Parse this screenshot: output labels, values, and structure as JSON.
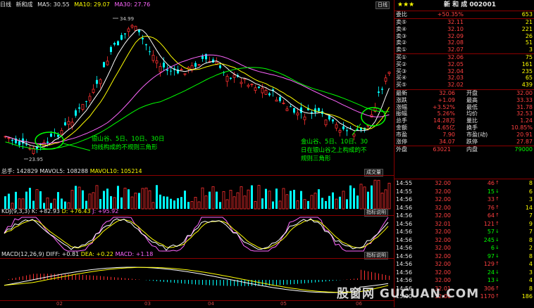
{
  "header": {
    "period": "日线",
    "stock_name": "新和成",
    "ma5": "MA5: 30.55",
    "ma10": "MA10: 29.07",
    "ma30": "MA30: 27.76",
    "top_right_label": "日线"
  },
  "main_chart": {
    "high_label": "34.99",
    "low_label": "23.95",
    "annotation_left_1": "银山谷、5日、10日、30日",
    "annotation_left_2": "均线构成的不规则三角形",
    "annotation_right_1": "金山谷、5日、10日、30",
    "annotation_right_2": "日在银山谷之上构成的不",
    "annotation_right_3": "规则三角形"
  },
  "volume_panel": {
    "total": "总手: 142829",
    "mavol5": "MAVOL5: 108288",
    "mavol10": "MAVOL10: 105214",
    "button": "成交量"
  },
  "kdj_panel": {
    "label": "KDJ(9,3,3)",
    "k": "K: +82.93",
    "d": "D: +76.43",
    "j": "J: +95.92",
    "button": "指标说明"
  },
  "macd_panel": {
    "label": "MACD(12,26,9)",
    "diff": "DIFF: +0.81",
    "dea": "DEA: +0.22",
    "macd": "MACD: +1.18",
    "button": "指标说明"
  },
  "x_axis": [
    "02",
    "03",
    "04",
    "05",
    "06"
  ],
  "watermark": "股窗网 GUCUAN.COM",
  "right_panel": {
    "stars": "★★★",
    "title": "新 和 成 002001",
    "weibi": {
      "label": "委比",
      "value": "+50.35%",
      "vol": "653"
    },
    "asks": [
      {
        "label": "卖⑤",
        "price": "32.11",
        "vol": "21"
      },
      {
        "label": "卖④",
        "price": "32.10",
        "vol": "221"
      },
      {
        "label": "卖③",
        "price": "32.09",
        "vol": "26"
      },
      {
        "label": "卖②",
        "price": "32.08",
        "vol": "51"
      },
      {
        "label": "卖①",
        "price": "32.07",
        "vol": "3"
      }
    ],
    "bids": [
      {
        "label": "买①",
        "price": "32.06",
        "vol": "75"
      },
      {
        "label": "买②",
        "price": "32.05",
        "vol": "161"
      },
      {
        "label": "买③",
        "price": "32.04",
        "vol": "235"
      },
      {
        "label": "买④",
        "price": "32.03",
        "vol": "65"
      },
      {
        "label": "买⑤",
        "price": "32.02",
        "vol": "439"
      }
    ],
    "stats": [
      {
        "l1": "最新",
        "v1": "32.06",
        "l2": "开盘",
        "v2": "32.00"
      },
      {
        "l1": "涨跌",
        "v1": "+1.09",
        "l2": "最高",
        "v2": "33.33"
      },
      {
        "l1": "涨幅",
        "v1": "+3.52%",
        "l2": "最低",
        "v2": "31.78"
      },
      {
        "l1": "振幅",
        "v1": "5.26%",
        "l2": "均价",
        "v2": "32.53"
      },
      {
        "l1": "总手",
        "v1": "14.28万",
        "l2": "量比",
        "v2": "1.24"
      },
      {
        "l1": "金额",
        "v1": "4.65亿",
        "l2": "换手",
        "v2": "10.85%"
      },
      {
        "l1": "市盈",
        "v1": "7.90",
        "l2": "市盈(动)",
        "v2": "20.91"
      },
      {
        "l1": "涨停",
        "v1": "34.07",
        "l2": "跌停",
        "v2": "27.87"
      }
    ],
    "outer": {
      "l1": "外盘",
      "v1": "63021",
      "l2": "内盘",
      "v2": "79000"
    },
    "ticks": [
      {
        "time": "14:55",
        "price": "32.00",
        "vol": "46",
        "dir": "up",
        "n": "8"
      },
      {
        "time": "14:55",
        "price": "32.00",
        "vol": "15",
        "dir": "down",
        "n": "6"
      },
      {
        "time": "14:56",
        "price": "32.00",
        "vol": "33",
        "dir": "up",
        "n": "3"
      },
      {
        "time": "14:56",
        "price": "32.00",
        "vol": "76",
        "dir": "up",
        "n": "14"
      },
      {
        "time": "14:56",
        "price": "32.00",
        "vol": "64",
        "dir": "up",
        "n": "7"
      },
      {
        "time": "14:56",
        "price": "32.01",
        "vol": "121",
        "dir": "up",
        "n": "9"
      },
      {
        "time": "14:56",
        "price": "32.00",
        "vol": "57",
        "dir": "down",
        "n": "7"
      },
      {
        "time": "14:56",
        "price": "32.00",
        "vol": "245",
        "dir": "down",
        "n": "8"
      },
      {
        "time": "14:56",
        "price": "32.00",
        "vol": "6",
        "dir": "down",
        "n": "2"
      },
      {
        "time": "14:56",
        "price": "32.00",
        "vol": "97",
        "dir": "down",
        "n": "8"
      },
      {
        "time": "14:56",
        "price": "32.00",
        "vol": "129",
        "dir": "up",
        "n": "4"
      },
      {
        "time": "14:56",
        "price": "32.00",
        "vol": "24",
        "dir": "down",
        "n": "3"
      },
      {
        "time": "14:56",
        "price": "32.00",
        "vol": "13",
        "dir": "down",
        "n": "4"
      },
      {
        "time": "14:56",
        "price": "32.01",
        "vol": "306",
        "dir": "up",
        "n": "8"
      },
      {
        "time": "15:00",
        "price": "32.06",
        "vol": "1170",
        "dir": "up",
        "n": "186"
      }
    ]
  }
}
